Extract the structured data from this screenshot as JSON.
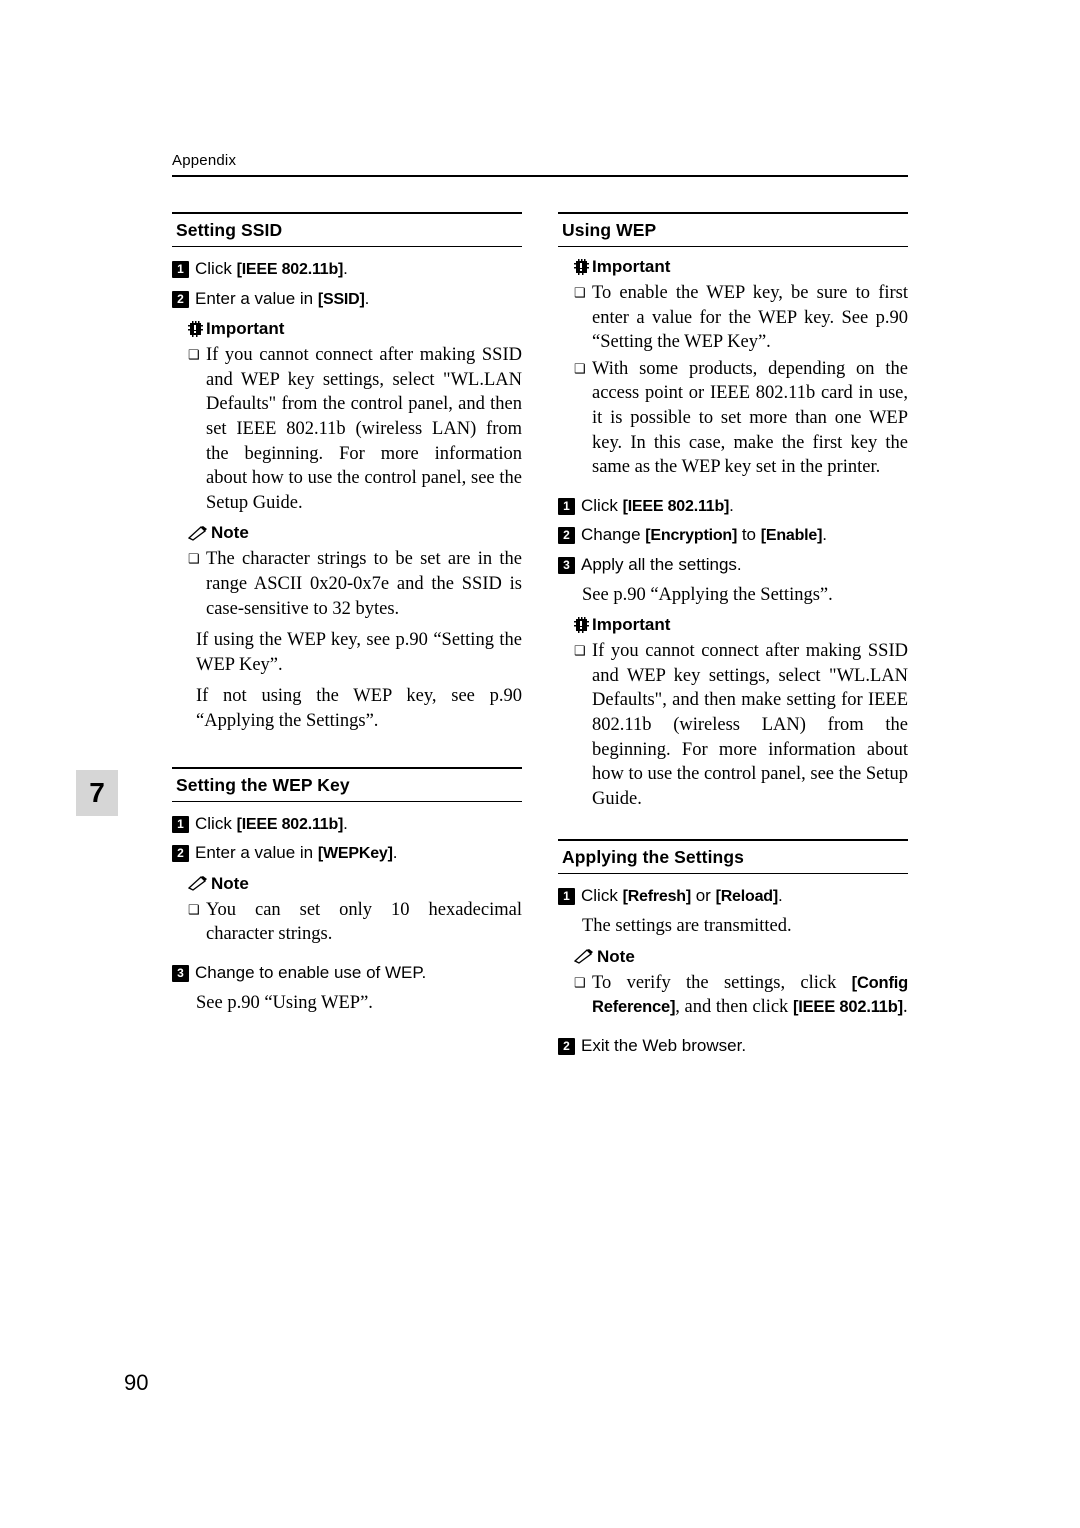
{
  "header": {
    "label": "Appendix"
  },
  "chapter_tab": {
    "number": "7"
  },
  "page_number": "90",
  "icons": {
    "important": "important-icon",
    "note": "pencil-note-icon"
  },
  "left_column": {
    "sections": [
      {
        "title": "Setting SSID",
        "steps": [
          {
            "num": "1",
            "prefix": "Click ",
            "kw": "[IEEE 802.11b]",
            "suffix": "."
          },
          {
            "num": "2",
            "prefix": "Enter a value in ",
            "kw": "[SSID]",
            "suffix": "."
          }
        ],
        "important_label": "Important",
        "important_bullets": [
          "If you cannot connect after making SSID and WEP key settings, select \"WL.LAN Defaults\" from the control panel, and then set IEEE 802.11b (wireless LAN) from the beginning. For more information about how to use the control panel, see the Setup Guide."
        ],
        "note_label": "Note",
        "note_bullets": [
          "The character strings to be set are in the range ASCII 0x20-0x7e and the SSID is case-sensitive to 32 bytes."
        ],
        "paragraphs": [
          "If using the WEP key, see p.90 “Setting the WEP Key”.",
          "If not using the WEP key, see p.90 “Applying the Settings”."
        ]
      },
      {
        "title": "Setting the WEP Key",
        "steps": [
          {
            "num": "1",
            "prefix": "Click ",
            "kw": "[IEEE 802.11b]",
            "suffix": "."
          },
          {
            "num": "2",
            "prefix": "Enter a value in ",
            "kw": "[WEPKey]",
            "suffix": "."
          }
        ],
        "note_label": "Note",
        "note_bullets": [
          "You can set only 10 hexadecimal character strings."
        ],
        "step3": {
          "num": "3",
          "text": "Change to enable use of WEP."
        },
        "paragraphs": [
          "See p.90 “Using WEP”."
        ]
      }
    ]
  },
  "right_column": {
    "sections": [
      {
        "title": "Using WEP",
        "important_label": "Important",
        "important_bullets": [
          "To enable the WEP key, be sure to first enter a value for the WEP key. See p.90 “Setting the WEP Key”.",
          "With some products, depending on the access point or IEEE 802.11b card in use, it is possible to set more than one WEP key. In this case, make the first key the same as the WEP key set in the printer."
        ],
        "steps": [
          {
            "num": "1",
            "prefix": "Click ",
            "kw": "[IEEE 802.11b]",
            "suffix": "."
          },
          {
            "num": "2",
            "prefix": "Change ",
            "kw": "[Encryption]",
            "mid": " to ",
            "kw2": "[Enable]",
            "suffix": "."
          },
          {
            "num": "3",
            "prefix": "Apply all the settings.",
            "kw": "",
            "suffix": ""
          }
        ],
        "after_steps_paragraph": "See p.90 “Applying the Settings”.",
        "important_label2": "Important",
        "important_bullets2": [
          "If you cannot connect after making SSID and WEP key settings, select \"WL.LAN Defaults\", and then make setting for IEEE 802.11b (wireless LAN) from the beginning. For more information about how to use the control panel, see the Setup Guide."
        ]
      },
      {
        "title": "Applying the Settings",
        "steps": [
          {
            "num": "1",
            "prefix": "Click ",
            "kw": "[Refresh]",
            "mid": " or ",
            "kw2": "[Reload]",
            "suffix": "."
          }
        ],
        "after_steps_paragraph": "The settings are transmitted.",
        "note_label": "Note",
        "note_bullets_rich": [
          {
            "pre": "To verify the settings, click ",
            "kw": "[Config Reference]",
            "post": ", and then click ",
            "kw2": "[IEEE 802.11b]",
            "end": "."
          }
        ],
        "step2": {
          "num": "2",
          "text": "Exit the Web browser."
        }
      }
    ]
  }
}
